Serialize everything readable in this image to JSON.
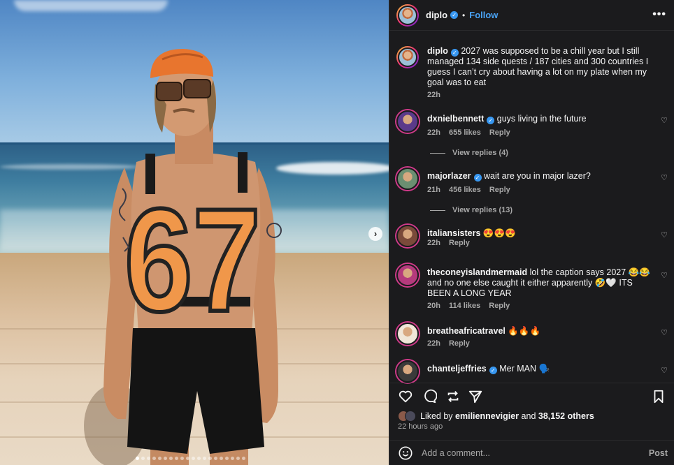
{
  "post": {
    "username": "diplo",
    "separator": "•",
    "follow_label": "Follow",
    "more_icon": "•••",
    "caption": "2027 was supposed to be a chill year but I still managed 134 side quests / 187 cities and 300 countries I guess I can’t cry about having a lot on my plate when my goal was to eat",
    "caption_time": "22h",
    "jersey_number": "67"
  },
  "comments": [
    {
      "username": "dxnielbennett",
      "verified": true,
      "text": "guys living in the future",
      "time": "22h",
      "likes": "655 likes",
      "reply": "Reply",
      "view_replies": "View replies (4)",
      "avatar_color": "#5b3a8a"
    },
    {
      "username": "majorlazer",
      "verified": true,
      "text": "wait are you in major lazer?",
      "time": "21h",
      "likes": "456 likes",
      "reply": "Reply",
      "view_replies": "View replies (13)",
      "avatar_color": "#6b8f71"
    },
    {
      "username": "italiansisters",
      "verified": false,
      "text": "😍😍😍",
      "time": "22h",
      "likes": "",
      "reply": "Reply",
      "view_replies": "",
      "avatar_color": "#7a4a3a"
    },
    {
      "username": "theconeyislandmermaid",
      "verified": false,
      "text": "lol the caption says 2027 😂😂 and no one else caught it either apparently 🤣🤍 ITS BEEN A LONG YEAR",
      "time": "20h",
      "likes": "114 likes",
      "reply": "Reply",
      "view_replies": "",
      "avatar_color": "#b43a7c"
    },
    {
      "username": "breatheafricatravel",
      "verified": false,
      "text": "🔥🔥🔥",
      "time": "22h",
      "likes": "",
      "reply": "Reply",
      "view_replies": "",
      "avatar_color": "#f0e6d8"
    },
    {
      "username": "chanteljeffries",
      "verified": true,
      "text": "Mer MAN 🗣️",
      "time": "",
      "likes": "",
      "reply": "",
      "view_replies": "",
      "avatar_color": "#3a3a3a"
    }
  ],
  "footer": {
    "liked_by_prefix": "Liked by",
    "liked_by_user": "emiliennevigier",
    "liked_by_and": "and",
    "liked_by_count": "38,152 others",
    "time_ago": "22 hours ago",
    "comment_placeholder": "Add a comment...",
    "post_label": "Post"
  },
  "icons": {
    "verified": "verified-badge-icon",
    "heart": "heart-icon",
    "comment": "comment-icon",
    "share": "repost-icon",
    "send": "send-icon",
    "save": "bookmark-icon",
    "emoji": "emoji-icon",
    "next": "chevron-right-icon"
  },
  "colors": {
    "accent": "#4aa3f5",
    "panel_bg": "#1b1b1d",
    "muted_text": "#a8a8a8",
    "verified": "#3897f0"
  },
  "carousel": {
    "total": 20,
    "active_index": 0
  }
}
